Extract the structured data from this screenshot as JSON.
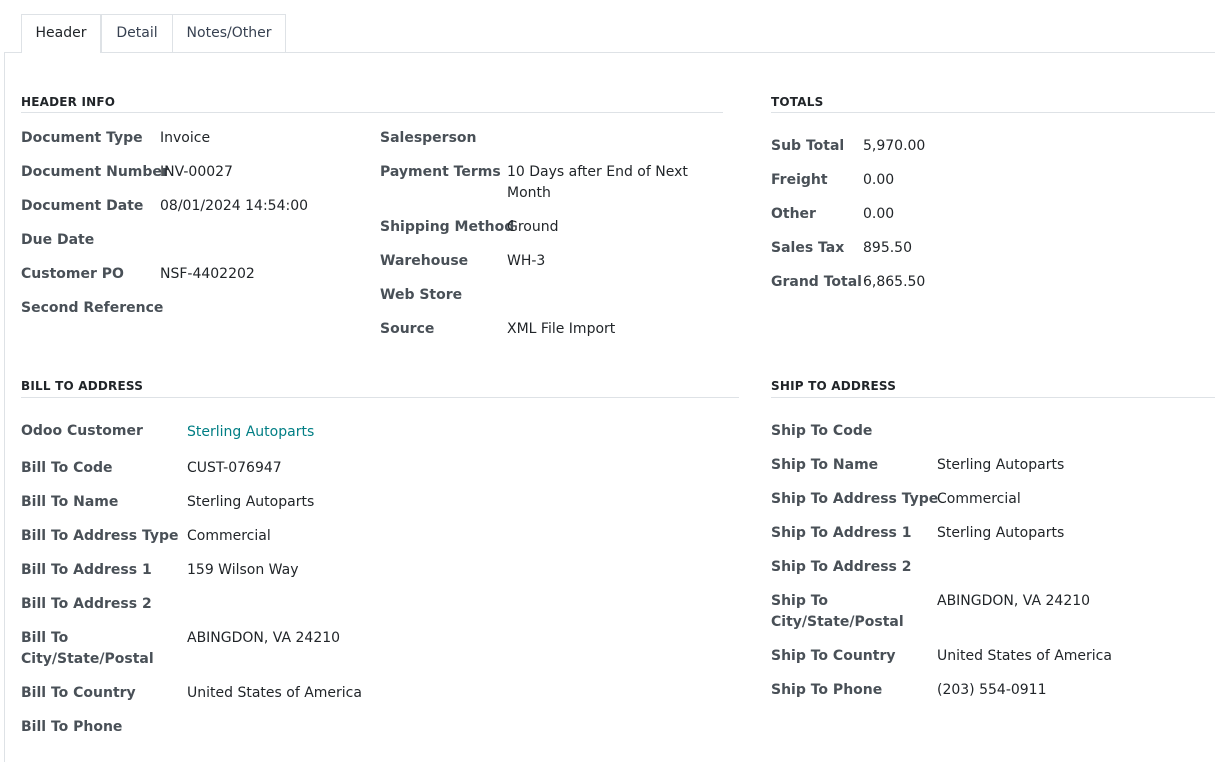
{
  "tabs": [
    {
      "label": "Header",
      "active": true
    },
    {
      "label": "Detail",
      "active": false
    },
    {
      "label": "Notes/Other",
      "active": false
    }
  ],
  "header_info": {
    "title": "HEADER INFO",
    "document_type": {
      "label": "Document Type",
      "value": "Invoice"
    },
    "document_number": {
      "label": "Document Number",
      "value": "INV-00027"
    },
    "document_date": {
      "label": "Document Date",
      "value": "08/01/2024 14:54:00"
    },
    "due_date": {
      "label": "Due Date",
      "value": ""
    },
    "customer_po": {
      "label": "Customer PO",
      "value": "NSF-4402202"
    },
    "second_reference": {
      "label": "Second Reference",
      "value": ""
    },
    "salesperson": {
      "label": "Salesperson",
      "value": ""
    },
    "payment_terms": {
      "label": "Payment Terms",
      "value_line1": "10 Days after End of Next",
      "value_line2": "Month"
    },
    "shipping_method": {
      "label": "Shipping Method",
      "value": "Ground"
    },
    "warehouse": {
      "label": "Warehouse",
      "value": "WH-3"
    },
    "web_store": {
      "label": "Web Store",
      "value": ""
    },
    "source": {
      "label": "Source",
      "value": "XML File Import"
    }
  },
  "totals": {
    "title": "TOTALS",
    "sub_total": {
      "label": "Sub Total",
      "value": "5,970.00"
    },
    "freight": {
      "label": "Freight",
      "value": "0.00"
    },
    "other": {
      "label": "Other",
      "value": "0.00"
    },
    "sales_tax": {
      "label": "Sales Tax",
      "value": "895.50"
    },
    "grand_total": {
      "label": "Grand Total",
      "value": "6,865.50"
    }
  },
  "bill_to": {
    "title": "BILL TO ADDRESS",
    "odoo_customer": {
      "label": "Odoo Customer",
      "value": "Sterling Autoparts"
    },
    "code": {
      "label": "Bill To Code",
      "value": "CUST-076947"
    },
    "name": {
      "label": "Bill To Name",
      "value": "Sterling Autoparts"
    },
    "address_type": {
      "label": "Bill To Address Type",
      "value": "Commercial"
    },
    "address1": {
      "label": "Bill To Address 1",
      "value": "159 Wilson Way"
    },
    "address2": {
      "label": "Bill To Address 2",
      "value": ""
    },
    "city_state_postal": {
      "label_line1": "Bill To",
      "label_line2": "City/State/Postal",
      "value": "ABINGDON, VA 24210"
    },
    "country": {
      "label": "Bill To Country",
      "value": "United States of America"
    },
    "phone": {
      "label": "Bill To Phone",
      "value": ""
    }
  },
  "ship_to": {
    "title": "SHIP TO ADDRESS",
    "code": {
      "label": "Ship To Code",
      "value": ""
    },
    "name": {
      "label": "Ship To Name",
      "value": "Sterling Autoparts"
    },
    "address_type": {
      "label": "Ship To Address Type",
      "value": "Commercial"
    },
    "address1": {
      "label": "Ship To Address 1",
      "value": "Sterling Autoparts"
    },
    "address2": {
      "label": "Ship To Address 2",
      "value": ""
    },
    "city_state_postal": {
      "label_line1": "Ship To",
      "label_line2": "City/State/Postal",
      "value": "ABINGDON, VA 24210"
    },
    "country": {
      "label": "Ship To Country",
      "value": "United States of America"
    },
    "phone": {
      "label": "Ship To Phone",
      "value": "(203) 554-0911"
    }
  }
}
